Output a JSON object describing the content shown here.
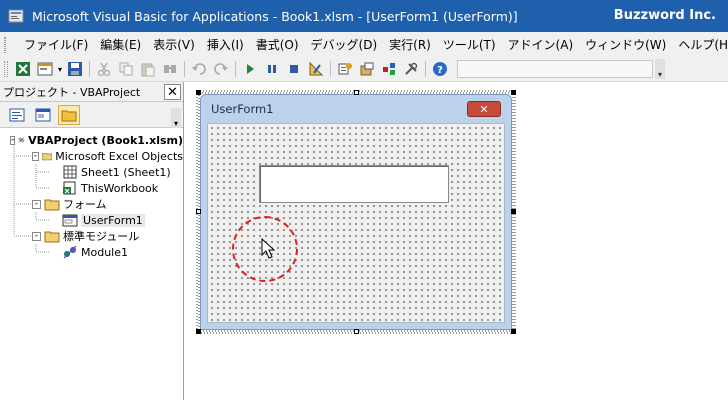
{
  "window": {
    "title": "Microsoft Visual Basic for Applications - Book1.xlsm - [UserForm1 (UserForm)]",
    "brand": "Buzzword Inc."
  },
  "menu": {
    "items": [
      "ファイル(F)",
      "編集(E)",
      "表示(V)",
      "挿入(I)",
      "書式(O)",
      "デバッグ(D)",
      "実行(R)",
      "ツール(T)",
      "アドイン(A)",
      "ウィンドウ(W)",
      "ヘルプ(H)"
    ]
  },
  "toolbar": {
    "buttons": [
      "excel-icon",
      "insert-userform-icon",
      "save-icon",
      "cut-icon",
      "copy-icon",
      "paste-icon",
      "find-icon",
      "undo-icon",
      "redo-icon",
      "run-icon",
      "break-icon",
      "reset-icon",
      "design-mode-icon",
      "project-explorer-icon",
      "properties-icon",
      "object-browser-icon",
      "toolbox-icon",
      "help-icon"
    ]
  },
  "project_panel": {
    "title": "プロジェクト - VBAProject",
    "close_label": "✕",
    "tree": [
      {
        "label": "VBAProject (Book1.xlsm)",
        "level": 0,
        "expander": "-",
        "icon": "vbaproject-icon",
        "bold": true
      },
      {
        "label": "Microsoft Excel Objects",
        "level": 1,
        "expander": "-",
        "icon": "folder-icon"
      },
      {
        "label": "Sheet1 (Sheet1)",
        "level": 2,
        "icon": "sheet-icon"
      },
      {
        "label": "ThisWorkbook",
        "level": 2,
        "icon": "workbook-icon"
      },
      {
        "label": "フォーム",
        "level": 1,
        "expander": "-",
        "icon": "folder-icon"
      },
      {
        "label": "UserForm1",
        "level": 2,
        "icon": "userform-icon",
        "selected": true
      },
      {
        "label": "標準モジュール",
        "level": 1,
        "expander": "-",
        "icon": "folder-icon"
      },
      {
        "label": "Module1",
        "level": 2,
        "icon": "module-icon"
      }
    ]
  },
  "designer": {
    "form_title": "UserForm1",
    "close_label": "✕"
  },
  "colors": {
    "titlebar": "#1f60ad",
    "form_border": "#bcd2ea",
    "highlight_circle": "#e02020"
  }
}
